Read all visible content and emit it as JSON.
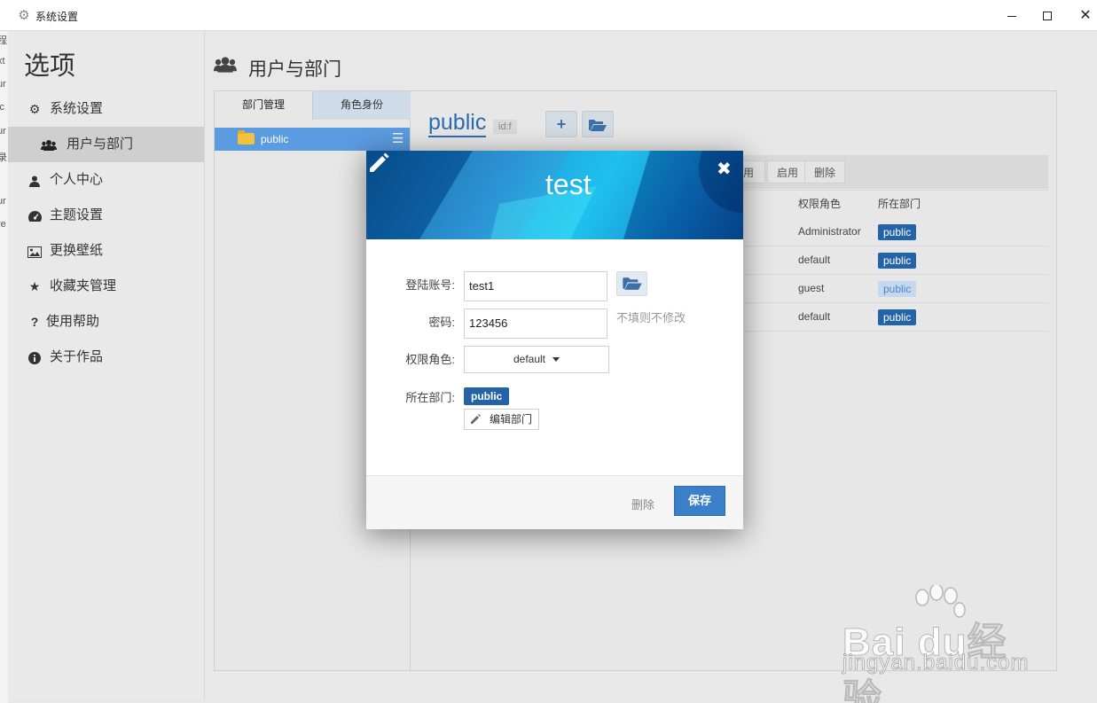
{
  "window": {
    "title": "系统设置"
  },
  "edge_fragments": [
    "程",
    "xt",
    "ur",
    "ic",
    "ur",
    "录",
    "ur",
    "re"
  ],
  "sidebar": {
    "heading": "选项",
    "items": [
      {
        "label": "系统设置",
        "icon": "gear-icon"
      },
      {
        "label": "用户与部门",
        "icon": "users-icon"
      },
      {
        "label": "个人中心",
        "icon": "user-icon"
      },
      {
        "label": "主题设置",
        "icon": "dashboard-icon"
      },
      {
        "label": "更换壁纸",
        "icon": "image-icon"
      },
      {
        "label": "收藏夹管理",
        "icon": "star-icon"
      },
      {
        "label": "使用帮助",
        "icon": "question-icon"
      },
      {
        "label": "关于作品",
        "icon": "info-icon"
      }
    ]
  },
  "main": {
    "title": "用户与部门",
    "tabs": [
      {
        "label": "部门管理"
      },
      {
        "label": "角色身份"
      }
    ],
    "departments": [
      {
        "name": "public"
      }
    ],
    "group": {
      "name": "public",
      "id": "id:f"
    },
    "toolbar": {
      "disable_partial": "用",
      "enable": "启用",
      "delete": "删除"
    },
    "table": {
      "headers": {
        "role": "权限角色",
        "dept": "所在部门"
      },
      "rows": [
        {
          "role": "Administrator",
          "dept": "public"
        },
        {
          "role": "default",
          "dept": "public"
        },
        {
          "role": "guest",
          "dept": "public"
        },
        {
          "role": "default",
          "dept": "public"
        }
      ]
    }
  },
  "modal": {
    "title": "test",
    "account_label": "登陆账号:",
    "account_value": "test1",
    "password_label": "密码:",
    "password_value": "123456",
    "password_hint": "不填则不修改",
    "role_label": "权限角色:",
    "role_value": "default",
    "dept_label": "所在部门:",
    "dept_value": "public",
    "edit_dept_label": "编辑部门",
    "delete_label": "删除",
    "save_label": "保存"
  },
  "watermark": {
    "brand": "Bai du经验",
    "url": "jingyan.baidu.com"
  },
  "colors": {
    "accent": "#2463a8",
    "save": "#3b7fc9",
    "selected": "#5b9be0"
  }
}
